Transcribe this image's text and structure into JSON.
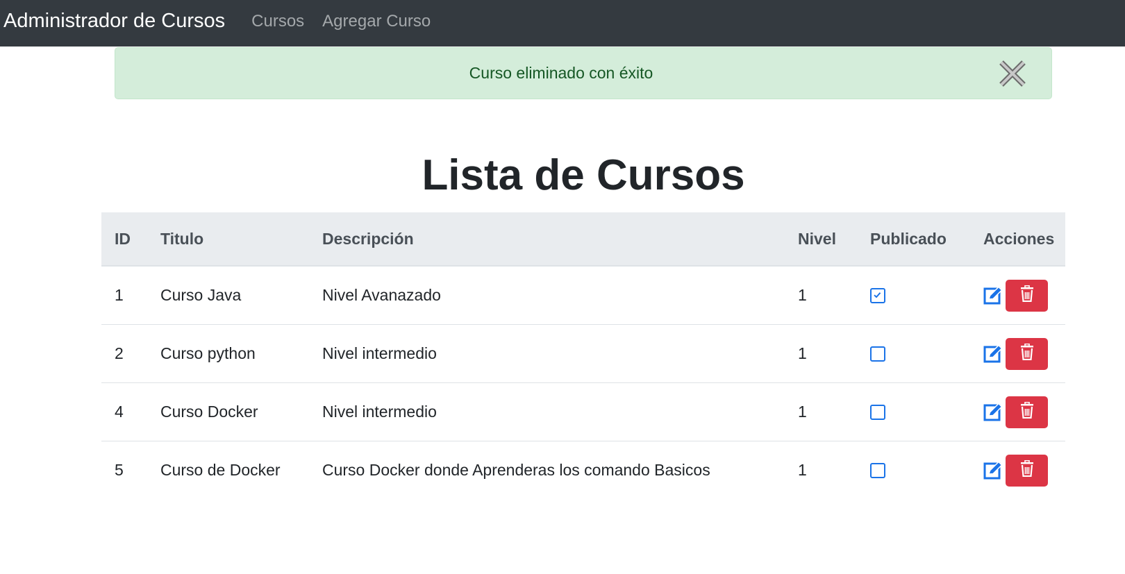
{
  "navbar": {
    "brand": "Administrador de Cursos",
    "links": [
      "Cursos",
      "Agregar Curso"
    ]
  },
  "alert": {
    "message": "Curso eliminado con éxito",
    "close_icon": "close-icon"
  },
  "page_title": "Lista de Cursos",
  "table": {
    "headers": [
      "ID",
      "Titulo",
      "Descripción",
      "Nivel",
      "Publicado",
      "Acciones"
    ],
    "rows": [
      {
        "id": "1",
        "titulo": "Curso Java",
        "descripcion": "Nivel Avanazado",
        "nivel": "1",
        "publicado": true
      },
      {
        "id": "2",
        "titulo": "Curso python",
        "descripcion": "Nivel intermedio",
        "nivel": "1",
        "publicado": false
      },
      {
        "id": "4",
        "titulo": "Curso Docker",
        "descripcion": "Nivel intermedio",
        "nivel": "1",
        "publicado": false
      },
      {
        "id": "5",
        "titulo": "Curso de Docker",
        "descripcion": "Curso Docker donde Aprenderas los comando Basicos",
        "nivel": "1",
        "publicado": false
      }
    ],
    "action_icons": {
      "edit": "edit-icon",
      "delete": "trash-icon"
    }
  },
  "colors": {
    "navbar": "#343a40",
    "alert_bg": "#d4edda",
    "alert_text": "#155724",
    "header_bg": "#e9ecef",
    "primary": "#1a73e8",
    "danger": "#dc3545"
  }
}
